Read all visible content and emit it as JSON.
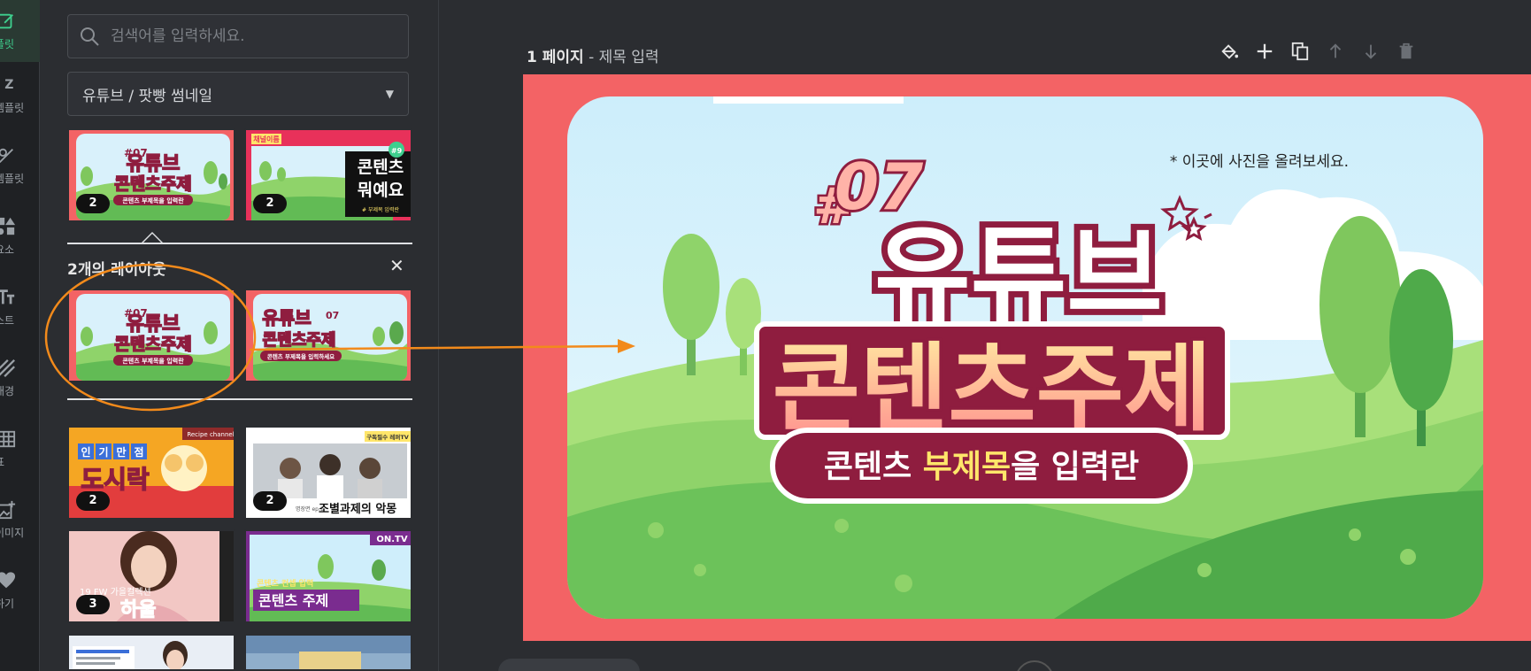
{
  "rail": {
    "items": [
      {
        "label": "플릿",
        "icon": "edit-template-icon"
      },
      {
        "label": "템플릿",
        "icon": "biz-text-icon",
        "prefix": "IZ"
      },
      {
        "label": "템플릿",
        "icon": "pen-template-icon"
      },
      {
        "label": "요소",
        "icon": "shapes-icon"
      },
      {
        "label": "스트",
        "icon": "text-icon"
      },
      {
        "label": "배경",
        "icon": "background-icon"
      },
      {
        "label": "표",
        "icon": "table-icon"
      },
      {
        "label": "이미지",
        "icon": "image-add-icon"
      },
      {
        "label": "하기",
        "icon": "heart-icon"
      }
    ]
  },
  "panel": {
    "search_placeholder": "검색어를 입력하세요.",
    "category": "유튜브 / 팟빵 썸네일",
    "top_thumbs": [
      {
        "badge": "2",
        "title_line1": "유튜브",
        "title_line2": "콘텐츠주제",
        "sub": "콘텐츠 부제목을 입력란",
        "num": "#07"
      },
      {
        "badge": "2",
        "title_line1": "콘텐츠",
        "title_line2": "뭐예요",
        "sub": "# 부제목 입력란",
        "tag": "채널이름",
        "num": "#9"
      }
    ],
    "layouts_title": "2개의 레이아웃",
    "layouts_close": "✕",
    "layouts": [
      {
        "title_line1": "유튜브",
        "title_line2": "콘텐츠주제",
        "sub": "콘텐츠 부제목을 입력란",
        "num": "#07"
      },
      {
        "title_line1": "유튜브",
        "title_line2": "콘텐츠주제",
        "sub": "콘텐츠 부제목을 입력하세요",
        "num": "07"
      }
    ],
    "more_thumbs": [
      {
        "badge": "2",
        "kind": "recipe",
        "corner": "Recipe channel",
        "tags": [
          "인",
          "기",
          "만",
          "점"
        ],
        "title": "도시락"
      },
      {
        "badge": "2",
        "kind": "people",
        "corner": "구독필수 레퍼TV",
        "caption": "조별과제의 악몽",
        "caption_pre": "명장면 ep.1"
      },
      {
        "badge": "3",
        "kind": "fashion",
        "caption": "19 FW 가을컬렉션",
        "title": "하울"
      },
      {
        "kind": "ontv",
        "corner": "ON.TV",
        "line1": "콘텐츠 컨셉 입력",
        "line2": "콘텐츠 주제"
      }
    ]
  },
  "main": {
    "page_num": "1 페이지",
    "page_sep": " - ",
    "page_title": "제목 입력",
    "canvas": {
      "hint": "* 이곳에 사진을 올려보세요.",
      "num": "07",
      "hash": "#",
      "title_line1": "유튜브",
      "title_line2": "콘텐츠주제",
      "sub_part1": "콘텐츠 ",
      "sub_highlight": "부제목",
      "sub_part2": "을 입력란"
    }
  },
  "colors": {
    "accent": "#3ecf8e",
    "canvas_bg": "#f36365",
    "title_dark": "#8f1d3f",
    "title_pink": "#ff9a9e",
    "highlight": "#ffe66a",
    "annotation": "#f28a1b"
  }
}
